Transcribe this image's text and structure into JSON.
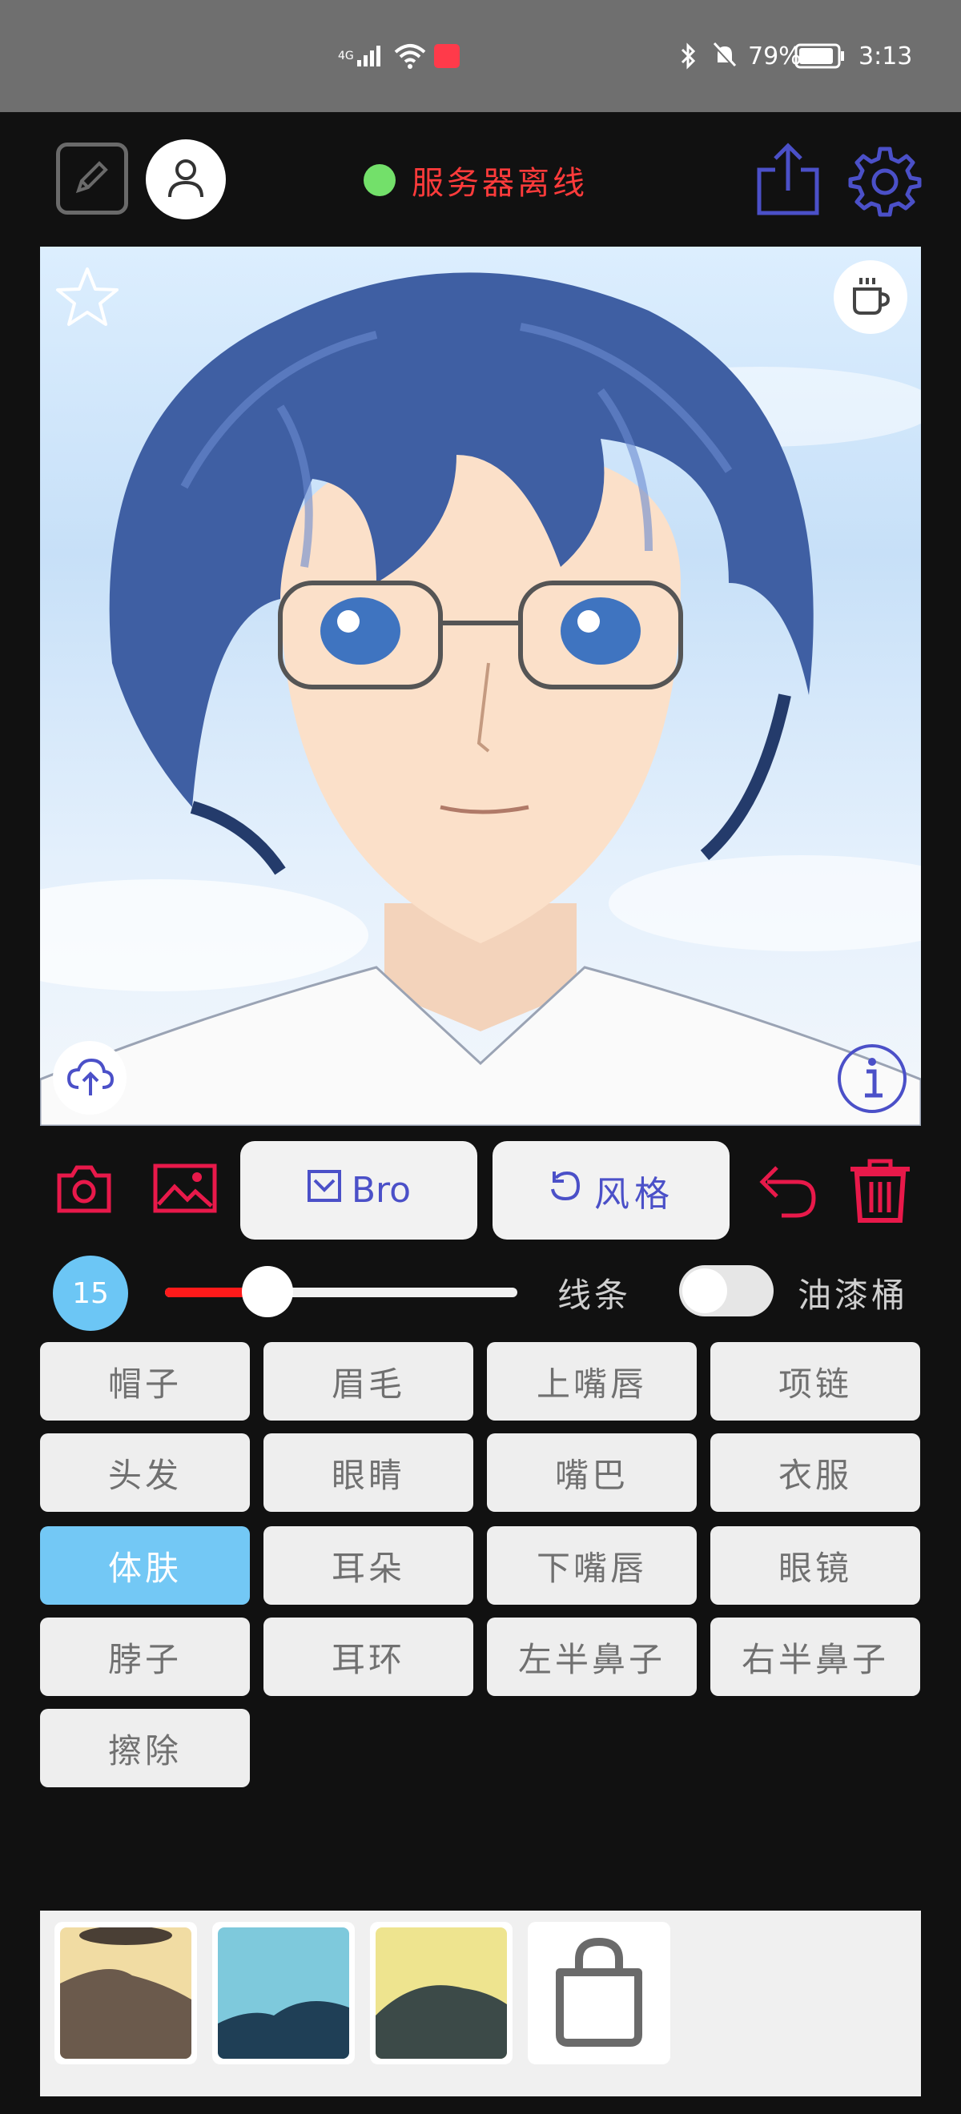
{
  "status_bar": {
    "network": "4G",
    "battery": "79%",
    "time": "3:13"
  },
  "header": {
    "server_status": "服务器离线",
    "server_dot_color": "#73e06a",
    "icons": [
      "edit-icon",
      "user-icon",
      "share-icon",
      "gear-icon"
    ]
  },
  "canvas": {
    "icons": [
      "star-icon",
      "coffee-icon",
      "cloud-upload-icon",
      "info-icon"
    ]
  },
  "toolbar": {
    "bro_label": "Bro",
    "style_label": "风格",
    "icons": [
      "camera-icon",
      "image-icon",
      "undo-icon",
      "trash-icon"
    ]
  },
  "brush": {
    "size": "15",
    "level": 0.29,
    "line_label": "线条",
    "bucket_label": "油漆桶"
  },
  "parts": [
    {
      "label": "帽子",
      "selected": false
    },
    {
      "label": "眉毛",
      "selected": false
    },
    {
      "label": "上嘴唇",
      "selected": false
    },
    {
      "label": "项链",
      "selected": false
    },
    {
      "label": "头发",
      "selected": false
    },
    {
      "label": "眼睛",
      "selected": false
    },
    {
      "label": "嘴巴",
      "selected": false
    },
    {
      "label": "衣服",
      "selected": false
    },
    {
      "label": "体肤",
      "selected": true
    },
    {
      "label": "耳朵",
      "selected": false
    },
    {
      "label": "下嘴唇",
      "selected": false
    },
    {
      "label": "眼镜",
      "selected": false
    },
    {
      "label": "脖子",
      "selected": false
    },
    {
      "label": "耳环",
      "selected": false
    },
    {
      "label": "左半鼻子",
      "selected": false
    },
    {
      "label": "右半鼻子",
      "selected": false
    },
    {
      "label": "擦除",
      "selected": false
    }
  ],
  "colors": {
    "accent_red": "#e8194a",
    "accent_blue": "#4b50c8",
    "selected_cell": "#73c8f5"
  }
}
